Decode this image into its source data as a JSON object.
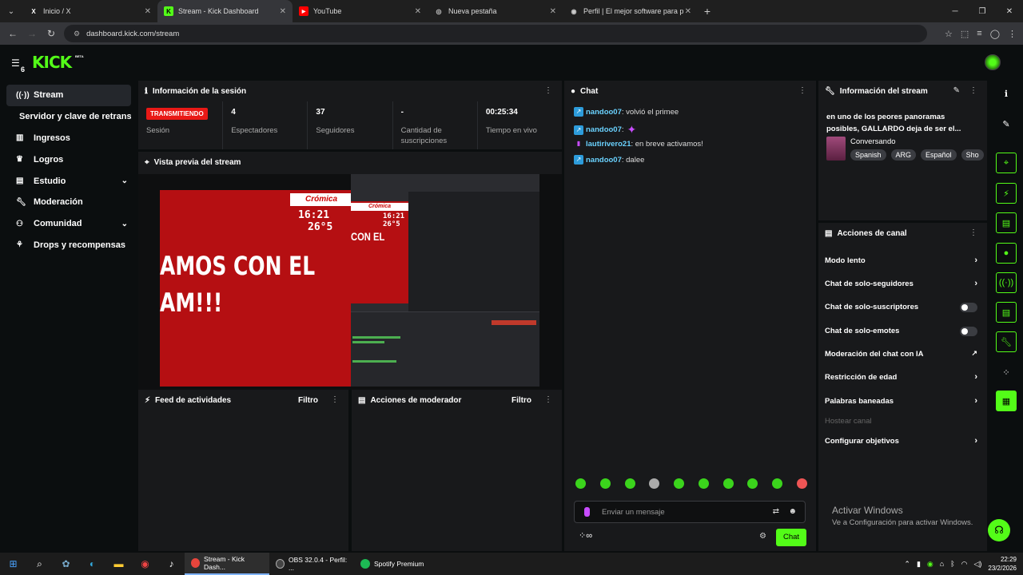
{
  "browser": {
    "tabs": [
      {
        "label": "Inicio / X",
        "icon": "x-logo-icon"
      },
      {
        "label": "Stream - Kick Dashboard",
        "icon": "kick-logo-icon",
        "active": true
      },
      {
        "label": "YouTube",
        "icon": "youtube-icon"
      },
      {
        "label": "Nueva pestaña",
        "icon": "globe-icon"
      },
      {
        "label": "Perfil | El mejor software para p",
        "icon": "obs-icon"
      }
    ],
    "url": "dashboard.kick.com/stream"
  },
  "header": {
    "logo": "KICK",
    "beta": "BETA",
    "notif_count": "6"
  },
  "sidebar": {
    "items": [
      {
        "label": "Stream",
        "icon": "stream-icon",
        "active": true
      },
      {
        "label": "Servidor y clave de retransmisión",
        "sub": true
      },
      {
        "label": "Ingresos",
        "icon": "chart-icon"
      },
      {
        "label": "Logros",
        "icon": "trophy-icon"
      },
      {
        "label": "Estudio",
        "icon": "studio-icon",
        "chevron": true
      },
      {
        "label": "Moderación",
        "icon": "wrench-icon"
      },
      {
        "label": "Comunidad",
        "icon": "community-icon",
        "chevron": true
      },
      {
        "label": "Drops y recompensas",
        "icon": "drops-icon"
      }
    ]
  },
  "session": {
    "title": "Información de la sesión",
    "live_badge": "TRANSMITIENDO",
    "stats": [
      {
        "value": "",
        "label": "Sesión"
      },
      {
        "value": "4",
        "label": "Espectadores"
      },
      {
        "value": "37",
        "label": "Seguidores"
      },
      {
        "value": "-",
        "label": "Cantidad de suscripciones"
      },
      {
        "value": "00:25:34",
        "label": "Tiempo en vivo"
      }
    ]
  },
  "preview": {
    "title": "Vista previa del stream",
    "overlay_brand": "Crómica",
    "overlay_time": "16:21",
    "overlay_temp": "26°5",
    "overlay_text_1": "AMOS CON EL",
    "overlay_text_2": "AM!!!",
    "obs_text": "CON EL"
  },
  "activity": {
    "title": "Feed de actividades",
    "filter": "Filtro"
  },
  "modactions": {
    "title": "Acciones de moderador",
    "filter": "Filtro"
  },
  "chat": {
    "title": "Chat",
    "messages": [
      {
        "user": "nandoo07",
        "text": ": volvió el primee",
        "color": "#6ad2ff"
      },
      {
        "user": "nandoo07",
        "text": ":",
        "color": "#6ad2ff",
        "emote": true
      },
      {
        "user": "lautirivero21",
        "text": ": en breve activamos!",
        "color": "#6ad2ff"
      },
      {
        "user": "nandoo07",
        "text": ": dalee",
        "color": "#6ad2ff"
      }
    ],
    "placeholder": "Enviar un mensaje",
    "send_label": "Chat"
  },
  "stream_info": {
    "title": "Información del stream",
    "stream_title": "en uno de los peores panoramas posibles, GALLARDO deja de ser el...",
    "category": "Conversando",
    "tags": [
      "Spanish",
      "ARG",
      "Español",
      "Sho"
    ]
  },
  "channel_actions": {
    "title": "Acciones de canal",
    "items": [
      {
        "label": "Modo lento",
        "type": "chevron"
      },
      {
        "label": "Chat de solo-seguidores",
        "type": "chevron"
      },
      {
        "label": "Chat de solo-suscriptores",
        "type": "toggle"
      },
      {
        "label": "Chat de solo-emotes",
        "type": "toggle"
      },
      {
        "label": "Moderación del chat con IA",
        "type": "external"
      },
      {
        "label": "Restricción de edad",
        "type": "chevron"
      },
      {
        "label": "Palabras baneadas",
        "type": "chevron"
      },
      {
        "label": "Hostear canal",
        "type": "disabled"
      },
      {
        "label": "Configurar objetivos",
        "type": "chevron"
      }
    ]
  },
  "windows_activation": {
    "line1": "Activar Windows",
    "line2": "Ve a Configuración para activar Windows."
  },
  "taskbar": {
    "apps": [
      {
        "label": "Stream - Kick Dash...",
        "active": true,
        "color": "#e8453c"
      },
      {
        "label": "OBS 32.0.4 - Perfil: ...",
        "color": "#444"
      },
      {
        "label": "Spotify Premium",
        "color": "#1db954"
      }
    ],
    "time": "22:29",
    "date": "23/2/2026"
  }
}
